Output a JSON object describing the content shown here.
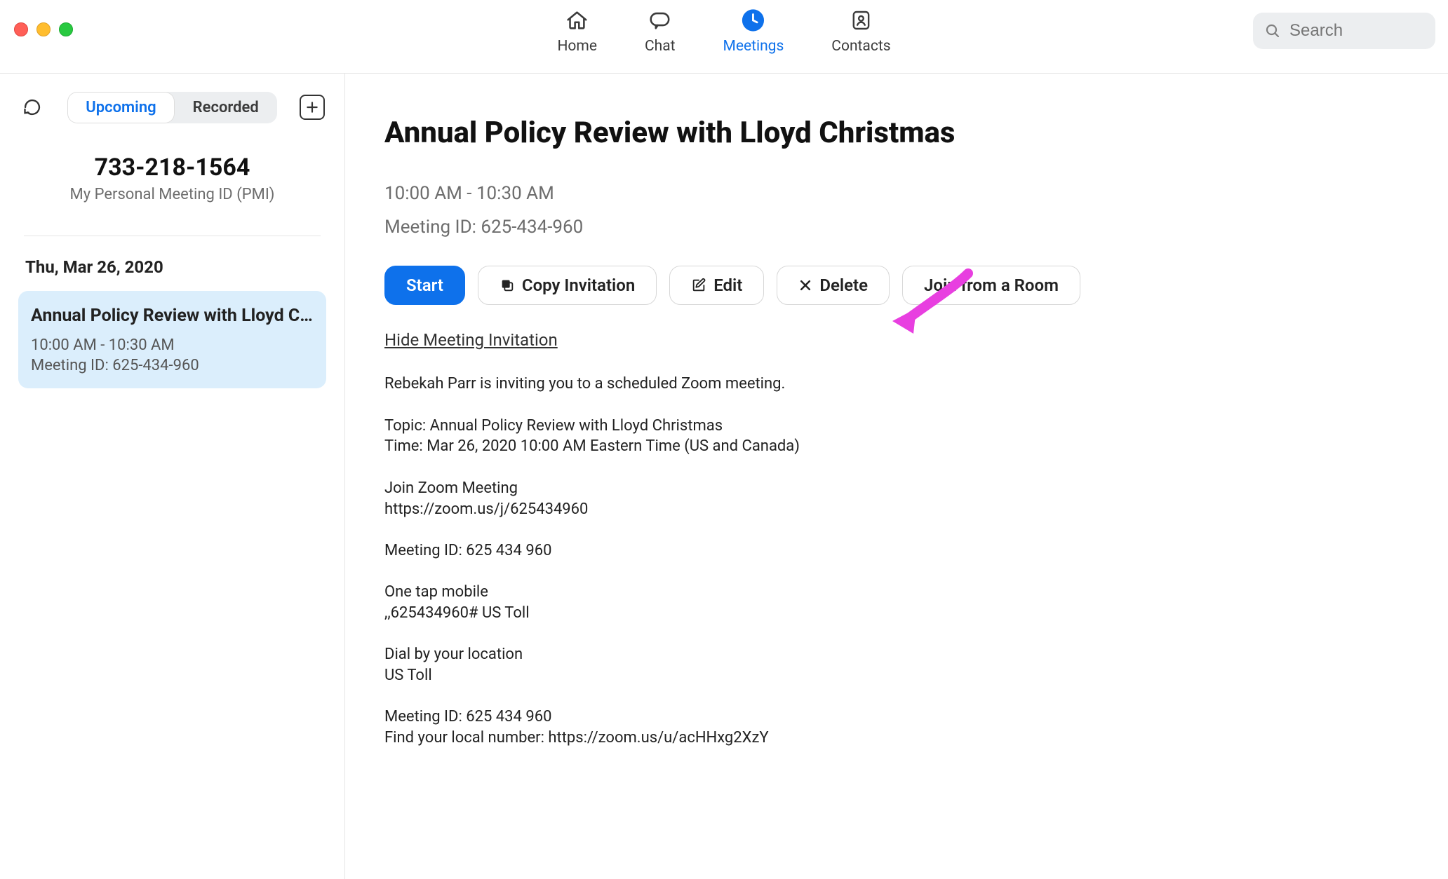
{
  "nav": {
    "home": "Home",
    "chat": "Chat",
    "meetings": "Meetings",
    "contacts": "Contacts"
  },
  "search": {
    "placeholder": "Search"
  },
  "sidebar": {
    "seg_upcoming": "Upcoming",
    "seg_recorded": "Recorded",
    "pmi_number": "733-218-1564",
    "pmi_label": "My Personal Meeting ID (PMI)",
    "date_header": "Thu, Mar 26, 2020",
    "meeting": {
      "title": "Annual Policy Review with Lloyd Chri...",
      "time": "10:00 AM - 10:30 AM",
      "id": "Meeting ID: 625-434-960"
    }
  },
  "main": {
    "title": "Annual Policy Review with Lloyd Christmas",
    "time": "10:00 AM - 10:30 AM",
    "meeting_id": "Meeting ID: 625-434-960",
    "buttons": {
      "start": "Start",
      "copy": "Copy Invitation",
      "edit": "Edit",
      "delete": "Delete",
      "join_room": "Join from a Room"
    },
    "hide_link": "Hide Meeting Invitation",
    "invitation": "Rebekah Parr is inviting you to a scheduled Zoom meeting.\n\nTopic: Annual Policy Review with Lloyd Christmas\nTime: Mar 26, 2020 10:00 AM Eastern Time (US and Canada)\n\nJoin Zoom Meeting\nhttps://zoom.us/j/625434960\n\nMeeting ID: 625 434 960\n\nOne tap mobile\n,,625434960# US Toll\n\nDial by your location\n         US Toll\n\nMeeting ID: 625 434 960\nFind your local number: https://zoom.us/u/acHHxg2XzY"
  },
  "colors": {
    "accent": "#0e71eb",
    "arrow": "#e83fe0",
    "select_bg": "#dbeefc"
  }
}
